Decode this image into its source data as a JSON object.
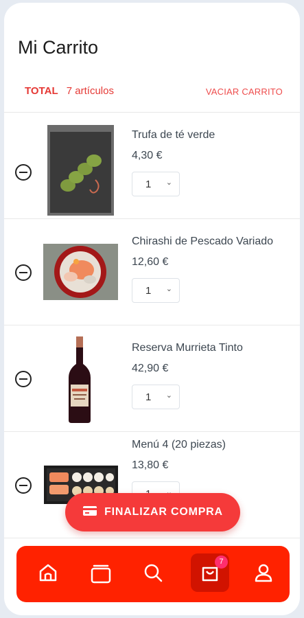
{
  "header": {
    "title": "Mi Carrito"
  },
  "summary": {
    "total_label": "TOTAL",
    "count_text": "7 artículos",
    "clear_label": "VACIAR CARRITO"
  },
  "items": [
    {
      "name": "Trufa de té verde",
      "price": "4,30 €",
      "qty": "1"
    },
    {
      "name": "Chirashi de Pescado Variado",
      "price": "12,60 €",
      "qty": "1"
    },
    {
      "name": "Reserva Murrieta Tinto",
      "price": "42,90 €",
      "qty": "1"
    },
    {
      "name": "Menú 4 (20 piezas)",
      "price": "13,80 €",
      "qty": "1"
    }
  ],
  "checkout": {
    "label": "FINALIZAR COMPRA",
    "icon": "credit-card-icon"
  },
  "nav": {
    "icons": [
      "home-icon",
      "catalog-icon",
      "search-icon",
      "cart-bag-icon",
      "user-icon"
    ],
    "cart_badge": "7"
  },
  "colors": {
    "accent": "#ff2200",
    "button": "#f53a3a",
    "text_red": "#e53935",
    "badge": "#ff2e6e"
  }
}
